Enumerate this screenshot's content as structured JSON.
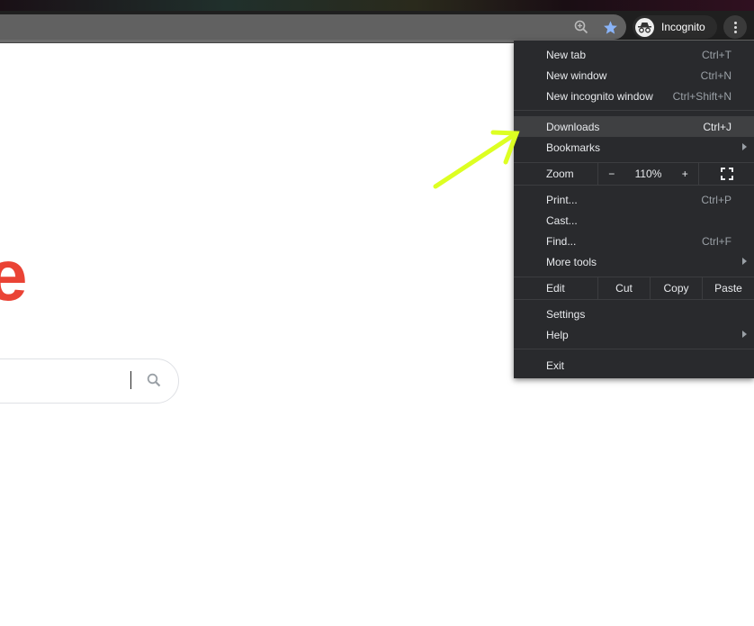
{
  "toolbar": {
    "zoom_icon": "zoom-in-icon",
    "bookmark_icon": "star-icon",
    "bookmark_color": "#8ab4f8",
    "profile_label": "Incognito",
    "menu_icon": "kebab-icon"
  },
  "page": {
    "logo_fragment": "e",
    "logo_color": "#ea4335",
    "search_icon": "search-icon"
  },
  "menu": {
    "new_tab": {
      "label": "New tab",
      "shortcut": "Ctrl+T"
    },
    "new_window": {
      "label": "New window",
      "shortcut": "Ctrl+N"
    },
    "new_incognito": {
      "label": "New incognito window",
      "shortcut": "Ctrl+Shift+N"
    },
    "downloads": {
      "label": "Downloads",
      "shortcut": "Ctrl+J"
    },
    "bookmarks": {
      "label": "Bookmarks"
    },
    "zoom": {
      "label": "Zoom",
      "minus": "−",
      "value": "110%",
      "plus": "+"
    },
    "print": {
      "label": "Print...",
      "shortcut": "Ctrl+P"
    },
    "cast": {
      "label": "Cast..."
    },
    "find": {
      "label": "Find...",
      "shortcut": "Ctrl+F"
    },
    "more_tools": {
      "label": "More tools"
    },
    "edit": {
      "label": "Edit",
      "cut": "Cut",
      "copy": "Copy",
      "paste": "Paste"
    },
    "settings": {
      "label": "Settings"
    },
    "help": {
      "label": "Help"
    },
    "exit": {
      "label": "Exit"
    }
  },
  "annotation": {
    "arrow_color": "#ddff22"
  }
}
